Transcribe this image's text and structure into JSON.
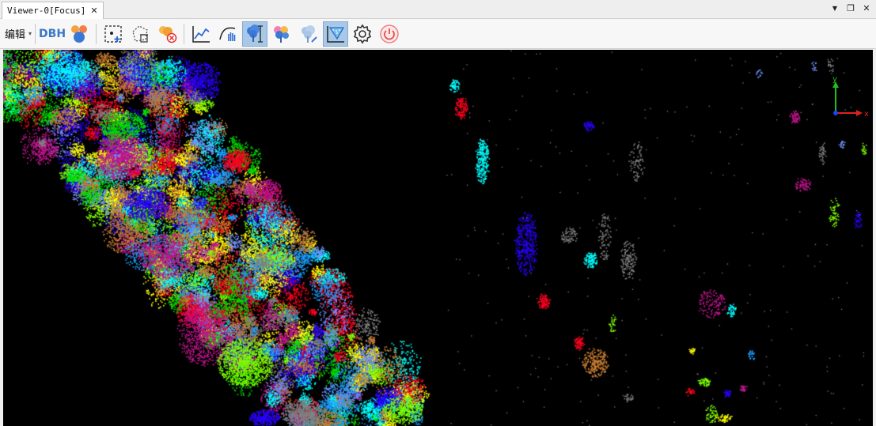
{
  "tab": {
    "title": "Viewer-0[Focus]",
    "close_glyph": "✕"
  },
  "window_controls": {
    "menu_glyph": "▼",
    "restore_glyph": "❐",
    "close_glyph": "✕"
  },
  "toolbar": {
    "edit_label": "编辑",
    "dbh_label": "DBH",
    "buttons": [
      {
        "icon": "dbh-icon",
        "active": false
      },
      {
        "icon": "colorize-clusters-icon",
        "active": false
      },
      {
        "icon": "add-point-icon",
        "active": false
      },
      {
        "icon": "polygon-delete-icon",
        "active": false
      },
      {
        "icon": "remove-cloud-icon",
        "active": false
      },
      {
        "icon": "profile-line-icon",
        "active": false
      },
      {
        "icon": "hand-curve-icon",
        "active": false
      },
      {
        "icon": "tree-height-icon",
        "active": true
      },
      {
        "icon": "tree-split-icon",
        "active": false
      },
      {
        "icon": "tree-edit-icon",
        "active": false
      },
      {
        "icon": "funnel-filter-icon",
        "active": true
      },
      {
        "icon": "settings-gear-icon",
        "active": false
      },
      {
        "icon": "power-icon",
        "active": false
      }
    ]
  },
  "viewport": {
    "background": "#000000",
    "axis_labels": {
      "x": "x",
      "y": "y"
    },
    "palette": [
      "#00ffff",
      "#1a9fff",
      "#2a00ff",
      "#c0158e",
      "#ff0020",
      "#7cff00",
      "#ffff00",
      "#c87d32",
      "#808080",
      "#00e000",
      "#6f8fff"
    ]
  }
}
